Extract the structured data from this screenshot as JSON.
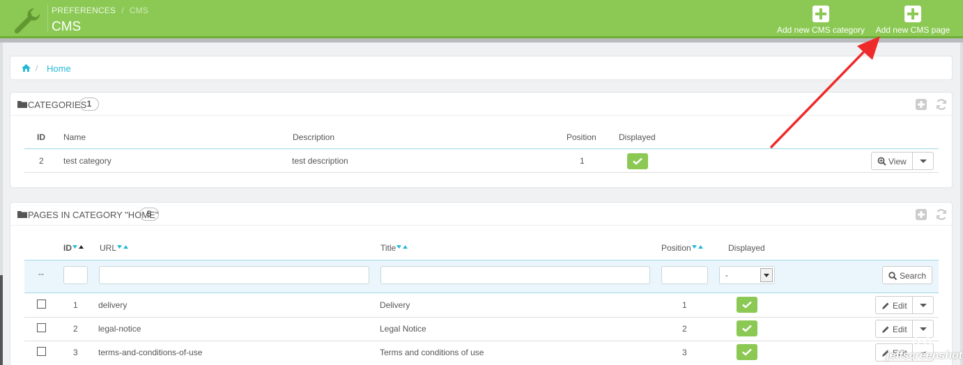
{
  "header": {
    "breadcrumb_parent": "PREFERENCES",
    "breadcrumb_separator": "/",
    "breadcrumb_current": "CMS",
    "title": "CMS",
    "add_category_label": "Add new CMS category",
    "add_page_label": "Add new CMS page",
    "accent_color": "#8bc954"
  },
  "breadcrumb": {
    "separator": "/",
    "home": "Home"
  },
  "categories": {
    "title": "CATEGORIES",
    "count": "1",
    "columns": {
      "id": "ID",
      "name": "Name",
      "description": "Description",
      "position": "Position",
      "displayed": "Displayed"
    },
    "rows": [
      {
        "id": "2",
        "name": "test category",
        "description": "test description",
        "position": "1",
        "displayed": true,
        "action": "View"
      }
    ]
  },
  "pages": {
    "title": "PAGES IN CATEGORY \"HOME\"",
    "count": "5",
    "columns": {
      "id": "ID",
      "url": "URL",
      "title": "Title",
      "position": "Position",
      "displayed": "Displayed"
    },
    "filter": {
      "bulk_placeholder": "--",
      "displayed_value": "-",
      "search_label": "Search"
    },
    "rows": [
      {
        "id": "1",
        "url": "delivery",
        "title": "Delivery",
        "position": "1",
        "displayed": true,
        "action": "Edit"
      },
      {
        "id": "2",
        "url": "legal-notice",
        "title": "Legal Notice",
        "position": "2",
        "displayed": true,
        "action": "Edit"
      },
      {
        "id": "3",
        "url": "terms-and-conditions-of-use",
        "title": "Terms and conditions of use",
        "position": "3",
        "displayed": true,
        "action": "Edit"
      }
    ]
  },
  "watermark": "jeffscreenshot"
}
